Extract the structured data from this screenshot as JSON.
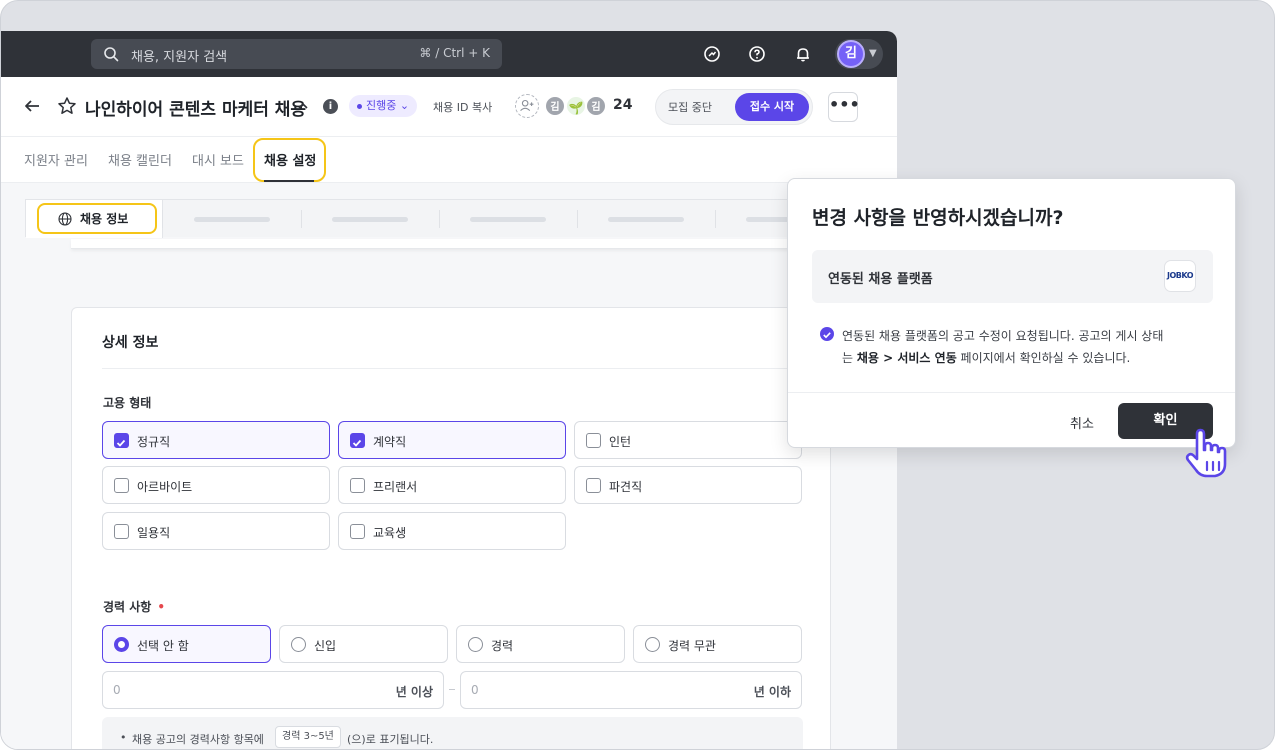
{
  "topbar": {
    "search_placeholder": "채용, 지원자 검색",
    "search_shortcut": "⌘ / Ctrl + K",
    "user_avatar": "김"
  },
  "header": {
    "title": "나인하이어 콘텐츠 마케터 채용",
    "status": "진행중",
    "copy_id": "채용 ID 복사",
    "members": [
      "김",
      "김"
    ],
    "member_count": "24",
    "stop_button": "모집 중단",
    "start_button": "접수 시작",
    "more": "•••"
  },
  "tabs": [
    "지원자 관리",
    "채용 캘린더",
    "대시 보드",
    "채용 설정"
  ],
  "subtab": {
    "label": "채용 정보"
  },
  "detail": {
    "title": "상세 정보",
    "employment_label": "고용 형태",
    "employment_options": [
      {
        "label": "정규직",
        "checked": true
      },
      {
        "label": "계약직",
        "checked": true
      },
      {
        "label": "인턴",
        "checked": false
      },
      {
        "label": "아르바이트",
        "checked": false
      },
      {
        "label": "프리랜서",
        "checked": false
      },
      {
        "label": "파견직",
        "checked": false
      },
      {
        "label": "일용직",
        "checked": false
      },
      {
        "label": "교육생",
        "checked": false
      }
    ],
    "career_label": "경력 사항",
    "required_mark": "•",
    "career_options": [
      {
        "label": "선택 안 함",
        "selected": true
      },
      {
        "label": "신입",
        "selected": false
      },
      {
        "label": "경력",
        "selected": false
      },
      {
        "label": "경력 무관",
        "selected": false
      }
    ],
    "min_years_value": "0",
    "min_years_unit": "년 이상",
    "max_years_value": "0",
    "max_years_unit": "년 이하",
    "note_bullet": "•",
    "note_prefix": "채용 공고의 경력사항 항목에",
    "note_tag": "경력 3~5년",
    "note_suffix": "(으)로 표기됩니다."
  },
  "modal": {
    "title": "변경 사항을 반영하시겠습니까?",
    "platform_label": "연동된 채용 플랫폼",
    "platform_logo": "JOBKO",
    "message_line1": "연동된 채용 플랫폼의 공고 수정이 요청됩니다. 공고의 게시 상태",
    "message_pre": "는 ",
    "message_bold": "채용 > 서비스 연동",
    "message_post": " 페이지에서 확인하실 수 있습니다.",
    "cancel": "취소",
    "confirm": "확인"
  },
  "colors": {
    "accent": "#5b46e8",
    "topbar": "#2f3238",
    "highlight": "#f5c518",
    "required": "#e5484d"
  }
}
